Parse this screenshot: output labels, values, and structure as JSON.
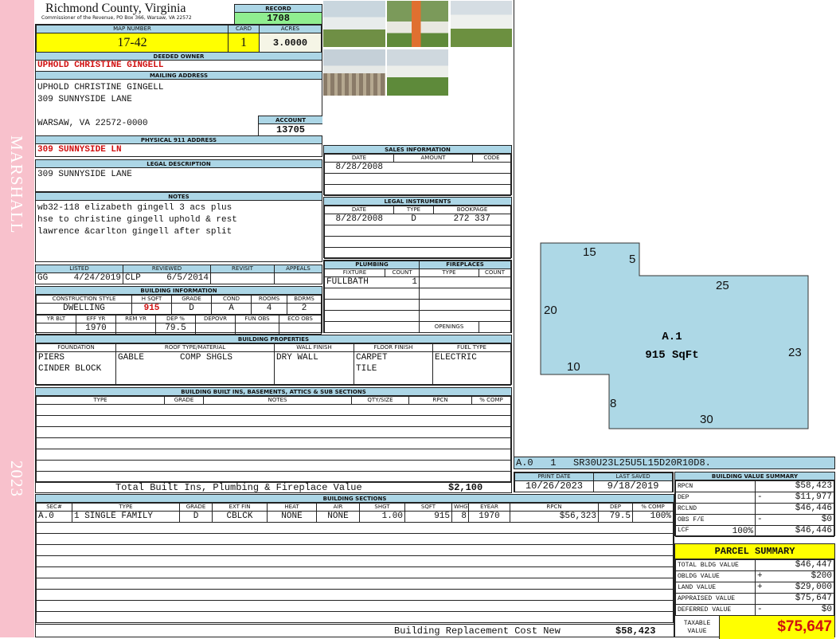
{
  "strip": {
    "top": "MARSHALL",
    "bottom": "2023"
  },
  "header": {
    "title": "Richmond County, Virginia",
    "subtitle": "Commissioner of the Revenue, PO Box 366, Warsaw, VA 22572",
    "record_label": "RECORD",
    "record": "1708",
    "map_label": "MAP NUMBER",
    "map": "17-42",
    "card_label": "CARD",
    "card": "1",
    "acres_label": "ACRES",
    "acres": "3.0000"
  },
  "owner": {
    "label": "DEEDED OWNER",
    "value": "UPHOLD CHRISTINE GINGELL"
  },
  "mailing": {
    "label": "MAILING ADDRESS",
    "line1": "UPHOLD CHRISTINE GINGELL",
    "line2": "309 SUNNYSIDE LANE",
    "line3": "WARSAW, VA 22572-0000",
    "account_label": "ACCOUNT",
    "account": "13705"
  },
  "physical": {
    "label": "PHYSICAL 911 ADDRESS",
    "value": "309 SUNNYSIDE LN"
  },
  "legal": {
    "label": "LEGAL DESCRIPTION",
    "value": "309 SUNNYSIDE LANE"
  },
  "notes": {
    "label": "NOTES",
    "lines": [
      "wb32-118 elizabeth gingell 3 acs plus",
      "hse to christine gingell uphold & rest",
      "lawrence &carlton gingell after split"
    ]
  },
  "listing": {
    "listed_label": "LISTED",
    "listed_by": "GG",
    "listed_date": "4/24/2019",
    "reviewed_label": "REVIEWED",
    "reviewed_by": "CLP",
    "reviewed_date": "6/5/2014",
    "revisit_label": "REVISIT",
    "appeals_label": "APPEALS"
  },
  "building_info": {
    "title": "BUILDING INFORMATION",
    "h1": [
      "CONSTRUCTION STYLE",
      "H SQFT",
      "GRADE",
      "COND",
      "ROOMS",
      "BDRMS"
    ],
    "v1": [
      "DWELLING",
      "915",
      "D",
      "A",
      "4",
      "2"
    ],
    "h2": [
      "YR BLT",
      "EFF YR",
      "REM YR",
      "DEP %",
      "DEPOVR",
      "FUN OBS",
      "ECO OBS"
    ],
    "v2": [
      "",
      "1970",
      "",
      "79.5",
      "",
      "",
      ""
    ]
  },
  "sales": {
    "title": "SALES INFORMATION",
    "cols": [
      "DATE",
      "AMOUNT",
      "CODE"
    ],
    "rows": [
      [
        "8/28/2008",
        "",
        ""
      ]
    ]
  },
  "legal_instruments": {
    "title": "LEGAL INSTRUMENTS",
    "cols": [
      "DATE",
      "TYPE",
      "BOOKPAGE"
    ],
    "rows": [
      [
        "8/28/2008",
        "D",
        "272 337"
      ]
    ]
  },
  "plumbing": {
    "title": "PLUMBING",
    "cols": [
      "FIXTURE",
      "COUNT"
    ],
    "rows": [
      [
        "FULLBATH",
        "1"
      ]
    ]
  },
  "fireplaces": {
    "title": "FIREPLACES",
    "cols": [
      "TYPE",
      "COUNT"
    ],
    "openings_label": "OPENINGS"
  },
  "properties": {
    "title": "BUILDING PROPERTIES",
    "cols": [
      "FOUNDATION",
      "ROOF TYPE/MATERIAL",
      "WALL FINISH",
      "FLOOR FINISH",
      "FUEL TYPE"
    ],
    "foundation": [
      "PIERS",
      "CINDER BLOCK"
    ],
    "roof_type": "GABLE",
    "roof_material": "COMP SHGLS",
    "wall": "DRY WALL",
    "floor": [
      "CARPET",
      "TILE"
    ],
    "fuel": "ELECTRIC"
  },
  "builtins": {
    "title": "BUILDING BUILT INS, BASEMENTS, ATTICS & SUB SECTIONS",
    "cols": [
      "TYPE",
      "GRADE",
      "NOTES",
      "QTY/SIZE",
      "RPCN",
      "% COMP"
    ],
    "total_label": "Total Built Ins, Plumbing & Fireplace Value",
    "total": "$2,100"
  },
  "sections": {
    "title": "BUILDING SECTIONS",
    "cols": [
      "SEC#",
      "TYPE",
      "GRADE",
      "EXT FIN",
      "HEAT",
      "AIR",
      "SHGT",
      "SQFT",
      "WHGT",
      "EYEAR",
      "RPCN",
      "DEP",
      "% COMP"
    ],
    "rows": [
      [
        "A.0",
        "1 SINGLE FAMILY",
        "D",
        "CBLCK",
        "NONE",
        "NONE",
        "1.00",
        "915",
        "8",
        "1970",
        "$56,323",
        "79.5",
        "100%"
      ]
    ],
    "replacement_label": "Building Replacement Cost New",
    "replacement": "$58,423"
  },
  "sketch": {
    "section": "A.1",
    "area": "915 SqFt",
    "labels": [
      "15",
      "5",
      "25",
      "20",
      "23",
      "10",
      "8",
      "30"
    ],
    "fill": "#add8e6",
    "code_sec": "A.0",
    "code_num": "1",
    "code": "SR30U23L25U5L15D20R10D8."
  },
  "dates": {
    "print_label": "PRINT DATE",
    "print": "10/26/2023",
    "saved_label": "LAST SAVED",
    "saved": "9/18/2019"
  },
  "value_summary": {
    "title": "BUILDING VALUE SUMMARY",
    "rows": [
      {
        "label": "RPCN",
        "op": "",
        "value": "$58,423"
      },
      {
        "label": "DEP",
        "op": "-",
        "value": "$11,977"
      },
      {
        "label": "RCLND",
        "op": "",
        "value": "$46,446"
      },
      {
        "label": "OBS F/E",
        "op": "-",
        "value": "$0"
      },
      {
        "label": "LCF",
        "pct": "100%",
        "op": "",
        "value": "$46,446"
      }
    ]
  },
  "parcel": {
    "title": "PARCEL SUMMARY",
    "rows": [
      {
        "label": "TOTAL BLDG VALUE",
        "op": "",
        "value": "$46,447"
      },
      {
        "label": "OBLDG VALUE",
        "op": "+",
        "value": "$200"
      },
      {
        "label": "LAND VALUE",
        "op": "+",
        "value": "$29,000"
      },
      {
        "label": "APPRAISED VALUE",
        "op": "",
        "value": "$75,647"
      },
      {
        "label": "DEFERRED VALUE",
        "op": "-",
        "value": "$0"
      }
    ],
    "taxable_label1": "TAXABLE",
    "taxable_label2": "VALUE",
    "taxable": "$75,647"
  },
  "colors": {
    "header_blue": "#acd6e6",
    "highlight_yellow": "#ffff00",
    "record_green": "#90ee90",
    "strip_pink": "#f8c1cc",
    "value_red": "#d01010"
  }
}
